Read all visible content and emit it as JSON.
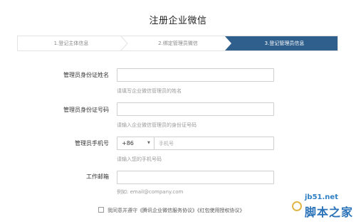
{
  "page": {
    "title": "注册企业微信"
  },
  "steps": [
    {
      "label": "1.登记主体信息"
    },
    {
      "label": "2.绑定管理员微信"
    },
    {
      "label": "3.登记管理员信息"
    }
  ],
  "form": {
    "name": {
      "label": "管理员身份证姓名",
      "value": "",
      "hint": "请填写企业微信管理员的姓名"
    },
    "id": {
      "label": "管理员身份证号码",
      "value": "",
      "hint": "请输入企业微信管理员的身份证号码"
    },
    "phone": {
      "label": "管理员手机号",
      "country_code": "+86",
      "placeholder": "手机号",
      "hint": "请输入您的手机号码"
    },
    "email": {
      "label": "工作邮箱",
      "value": "",
      "hint": "例如: email@company.com"
    }
  },
  "agreement": {
    "prefix": "我同意并遵守",
    "link1": "《腾讯企业微信服务协议》",
    "link2": "《红包使用授权协议》"
  },
  "watermark": {
    "site": "jb51.net",
    "name": "脚本之家"
  },
  "colors": {
    "accent": "#2f5f8c",
    "border": "#cfcfcf",
    "hint": "#999999"
  }
}
